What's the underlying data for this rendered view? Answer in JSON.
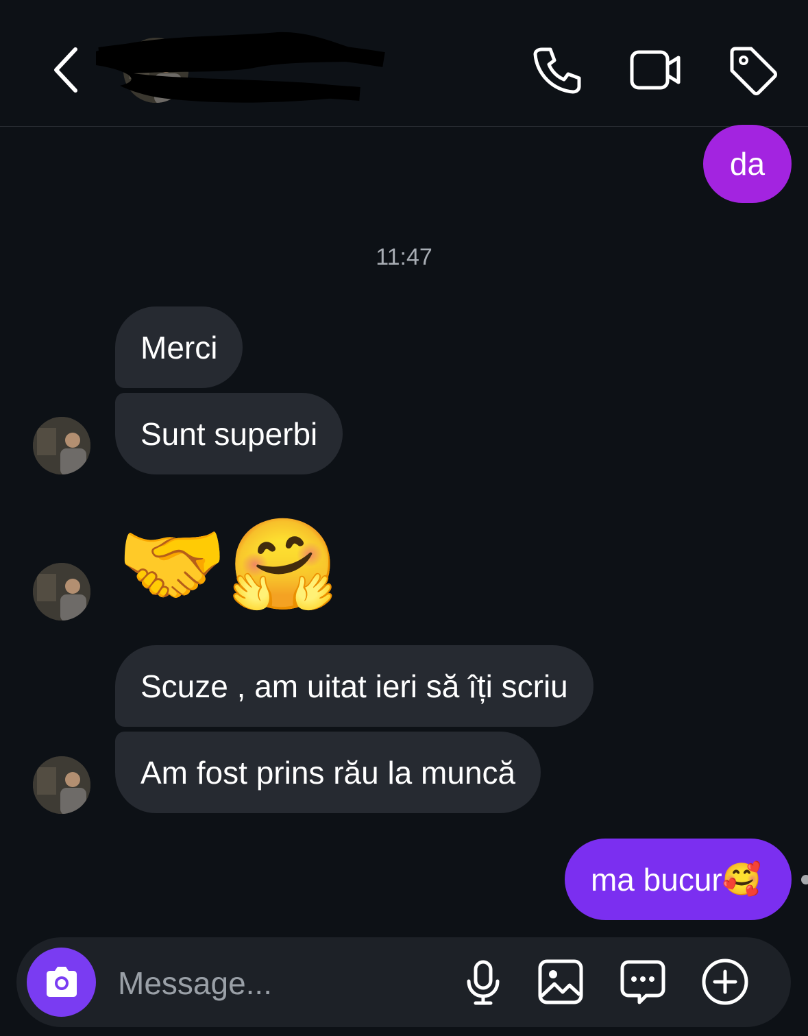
{
  "header": {
    "name": "",
    "username": "",
    "icons": [
      "back-arrow-icon",
      "phone-icon",
      "video-camera-icon",
      "tag-icon"
    ]
  },
  "messages": {
    "out_1": "da",
    "timestamp": "11:47",
    "in_1": "Merci",
    "in_2": "Sunt superbi",
    "emoji_1": "🤝",
    "emoji_2": "🤗",
    "in_3": "Scuze , am uitat ieri să îți scriu",
    "in_4": "Am fost prins rău la muncă",
    "out_2_text": "ma bucur",
    "out_2_emoji": "🥰"
  },
  "composer": {
    "placeholder": "Message...",
    "icons": [
      "camera-icon",
      "microphone-icon",
      "gallery-icon",
      "sticker-chat-icon",
      "plus-icon"
    ]
  },
  "colors": {
    "background": "#0d1116",
    "incoming_bubble": "#262a31",
    "outgoing_bubble_top": "#a324e0",
    "outgoing_bubble_bottom": "#7b2ff0",
    "camera_button": "#7a3cf2"
  }
}
